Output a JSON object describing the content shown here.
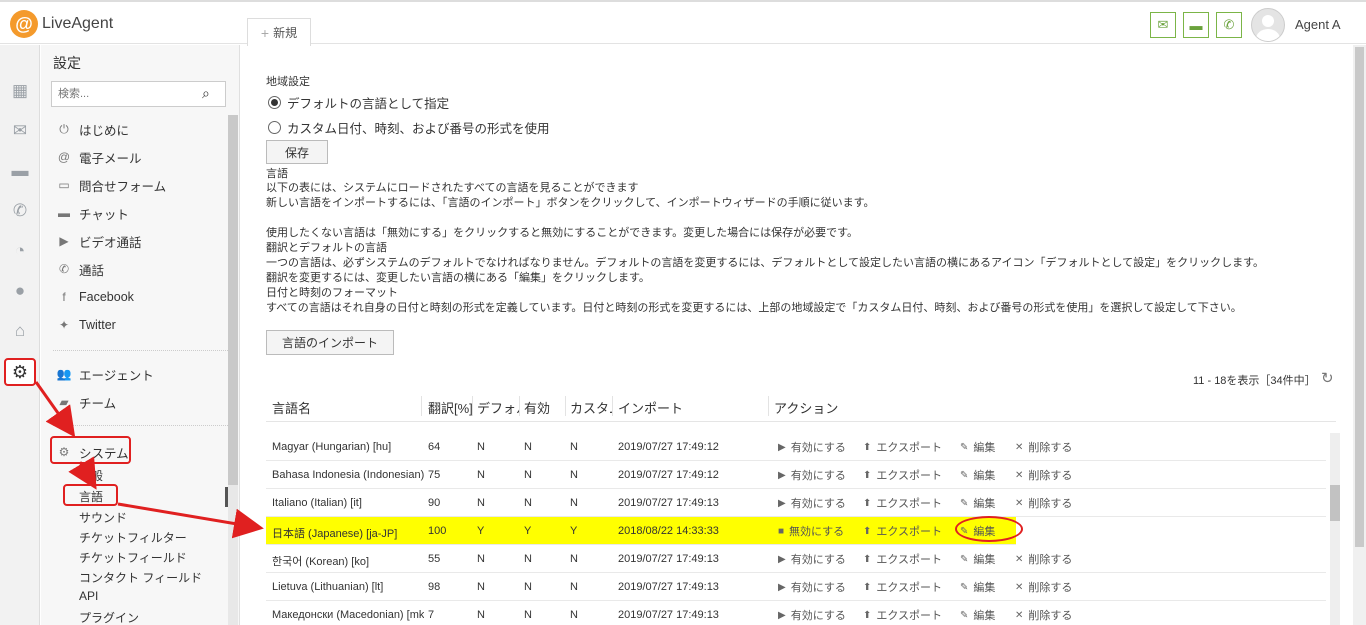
{
  "app": {
    "logo_letter": "@",
    "logo_text": "LiveAgent"
  },
  "topbar": {
    "new_tab_label": "新規",
    "icons": [
      "mail-icon",
      "chat-icon",
      "phone-icon"
    ],
    "agent_name": "Agent A"
  },
  "rail": {
    "icons": [
      "dashboard-icon",
      "mail-icon",
      "chat-icon",
      "phone-icon",
      "reports-icon",
      "contacts-icon",
      "knowledgebase-icon",
      "settings-icon"
    ]
  },
  "sidebar": {
    "title": "設定",
    "search_placeholder": "検索...",
    "items": [
      {
        "icon": "⏻",
        "label": "はじめに"
      },
      {
        "icon": "@",
        "label": "電子メール"
      },
      {
        "icon": "▭",
        "label": "問合せフォーム"
      },
      {
        "icon": "▬",
        "label": "チャット"
      },
      {
        "icon": "▶",
        "label": "ビデオ通話"
      },
      {
        "icon": "✆",
        "label": "通話"
      },
      {
        "icon": "f",
        "label": "Facebook"
      },
      {
        "icon": "✦",
        "label": "Twitter"
      }
    ],
    "agents_label": "エージェント",
    "teams_label": "チーム",
    "system_label": "システム",
    "sub_items": [
      "一般",
      "言語",
      "サウンド",
      "チケットフィルター",
      "チケットフィールド",
      "コンタクト フィールド",
      "API",
      "プラグイン"
    ]
  },
  "main": {
    "regional_label": "地域設定",
    "radio_default": "デフォルトの言語として指定",
    "radio_custom": "カスタム日付、時刻、および番号の形式を使用",
    "save_label": "保存",
    "desc_lines": [
      "言語",
      "以下の表には、システムにロードされたすべての言語を見ることができます",
      "新しい言語をインポートするには、「言語のインポート」ボタンをクリックして、インポートウィザードの手順に従います。",
      "",
      "使用したくない言語は「無効にする」をクリックすると無効にすることができます。変更した場合には保存が必要です。",
      "翻訳とデフォルトの言語",
      "一つの言語は、必ずシステムのデフォルトでなければなりません。デフォルトの言語を変更するには、デフォルトとして設定したい言語の横にあるアイコン「デフォルトとして設定」をクリックします。",
      "翻訳を変更するには、変更したい言語の横にある「編集」をクリックします。",
      "日付と時刻のフォーマット",
      "すべての言語はそれ自身の日付と時刻の形式を定義しています。日付と時刻の形式を変更するには、上部の地域設定で「カスタム日付、時刻、および番号の形式を使用」を選択して設定して下さい。"
    ],
    "import_label": "言語のインポート",
    "count_text": "11 - 18を表示［34件中］"
  },
  "table": {
    "headers": [
      "言語名",
      "翻訳[%]",
      "デフォルト",
      "有効",
      "カスタム",
      "インポート",
      "アクション"
    ],
    "rows": [
      {
        "name": "Magyar (Hungarian) [hu]",
        "pct": "64",
        "def": "N",
        "en": "N",
        "cus": "N",
        "imp": "2019/07/27 17:49:12",
        "toggle": "有効にする",
        "export": "エクスポート",
        "edit": "編集",
        "delete": "削除する"
      },
      {
        "name": "Bahasa Indonesia (Indonesian) [id]",
        "pct": "75",
        "def": "N",
        "en": "N",
        "cus": "N",
        "imp": "2019/07/27 17:49:12",
        "toggle": "有効にする",
        "export": "エクスポート",
        "edit": "編集",
        "delete": "削除する"
      },
      {
        "name": "Italiano (Italian) [it]",
        "pct": "90",
        "def": "N",
        "en": "N",
        "cus": "N",
        "imp": "2019/07/27 17:49:13",
        "toggle": "有効にする",
        "export": "エクスポート",
        "edit": "編集",
        "delete": "削除する"
      },
      {
        "name": "日本語 (Japanese) [ja-JP]",
        "pct": "100",
        "def": "Y",
        "en": "Y",
        "cus": "Y",
        "imp": "2018/08/22 14:33:33",
        "toggle": "無効にする",
        "export": "エクスポート",
        "edit": "編集",
        "delete": ""
      },
      {
        "name": "한국어 (Korean) [ko]",
        "pct": "55",
        "def": "N",
        "en": "N",
        "cus": "N",
        "imp": "2019/07/27 17:49:13",
        "toggle": "有効にする",
        "export": "エクスポート",
        "edit": "編集",
        "delete": "削除する"
      },
      {
        "name": "Lietuva (Lithuanian) [lt]",
        "pct": "98",
        "def": "N",
        "en": "N",
        "cus": "N",
        "imp": "2019/07/27 17:49:13",
        "toggle": "有効にする",
        "export": "エクスポート",
        "edit": "編集",
        "delete": "削除する"
      },
      {
        "name": "Македонски (Macedonian) [mk]",
        "pct": "7",
        "def": "N",
        "en": "N",
        "cus": "N",
        "imp": "2019/07/27 17:49:13",
        "toggle": "有効にする",
        "export": "エクスポート",
        "edit": "編集",
        "delete": "削除する"
      }
    ]
  },
  "colors": {
    "accent_green": "#6aa23c",
    "highlight_yellow": "#ffff00",
    "annotation_red": "#e02020",
    "logo_orange": "#f49a2c"
  }
}
